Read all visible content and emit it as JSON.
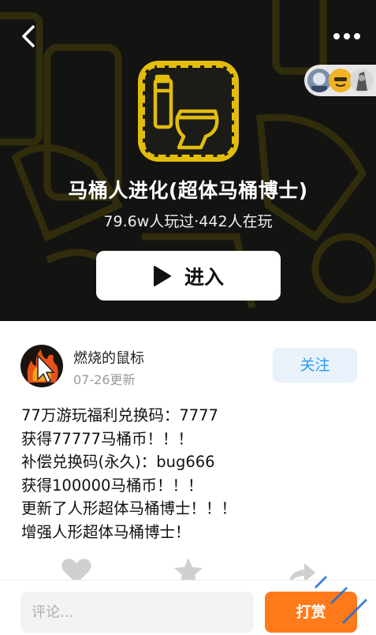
{
  "game": {
    "title": "马桶人进化(超体马桶博士)",
    "stats": "79.6w人玩过·442人在玩",
    "enter_label": "进入"
  },
  "post": {
    "author": "燃烧的鼠标",
    "date": "07-26更新",
    "follow_label": "关注",
    "lines": [
      "77万游玩福利兑换码：7777",
      "获得77777马桶币！！！",
      "补偿兑换码(永久)：bug666",
      "获得100000马桶币！！！",
      "更新了人形超体马桶博士！！！",
      "增强人形超体马桶博士！"
    ]
  },
  "comment": {
    "placeholder": "评论...",
    "tip_label": "打赏"
  },
  "icons": {
    "back": "back-arrow-icon",
    "more": "more-dots-icon",
    "play": "play-icon",
    "like": "heart-icon",
    "favorite": "star-icon",
    "share": "share-icon"
  },
  "colors": {
    "accent_blue": "#2a9bf4",
    "tip_orange": "#ff7a1a",
    "hero_dark": "#1e1e1c",
    "game_yellow": "#e2bd0b"
  }
}
